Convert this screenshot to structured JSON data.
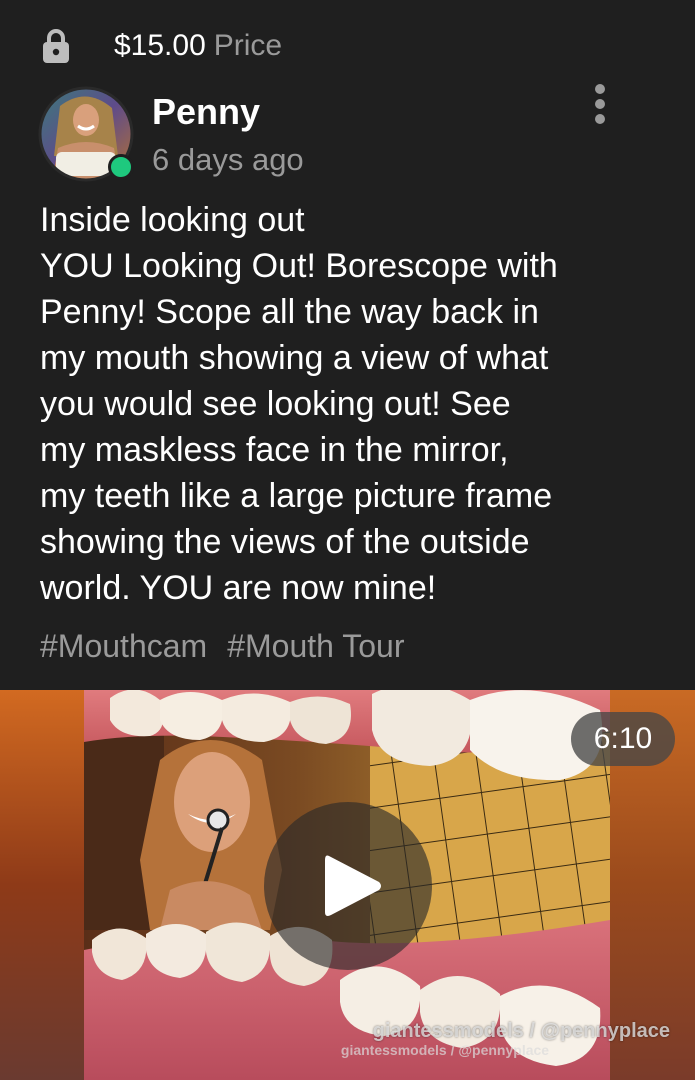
{
  "price": {
    "amount": "$15.00",
    "suffix": "Price",
    "icon": "lock-icon"
  },
  "author": {
    "name": "Penny",
    "time": "6 days ago",
    "online": true,
    "online_color": "#1ec97e"
  },
  "post": {
    "lines": [
      "Inside looking out",
      "YOU Looking Out! Borescope with",
      "Penny! Scope all the way back in",
      "my mouth showing a view of what",
      "you would see looking out! See",
      "my maskless face in the mirror,",
      "my teeth like a large picture frame",
      "showing the views of the outside",
      "world. YOU are now mine!"
    ],
    "tags": [
      "#Mouthcam",
      "#Mouth Tour"
    ]
  },
  "video": {
    "duration": "6:10",
    "watermark": "giantessmodels / @pennyplace",
    "watermark_small": "giantessmodels / @pennyplace"
  },
  "colors": {
    "background": "#1f1f1f",
    "muted_text": "#9a9a9a",
    "primary_text": "#ffffff"
  }
}
